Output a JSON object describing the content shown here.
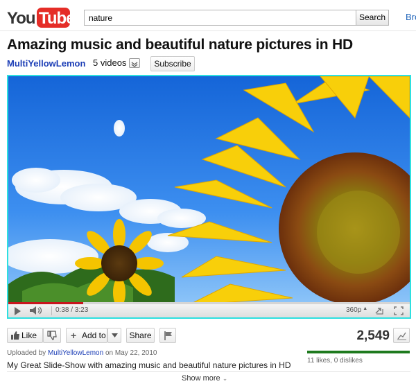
{
  "header": {
    "logo_text": "YouTube",
    "search_value": "nature",
    "search_button_label": "Search",
    "browse_link": "Bro"
  },
  "video": {
    "title": "Amazing music and beautiful nature pictures in HD",
    "channel": "MultiYellowLemon",
    "videos_count_label": "5 videos",
    "subscribe_label": "Subscribe"
  },
  "player": {
    "time": "0:38 / 3:23",
    "progress_fraction": 0.187,
    "quality": "360p"
  },
  "actions": {
    "like_label": "Like",
    "add_to_label": "Add to",
    "share_label": "Share",
    "view_count": "2,549"
  },
  "meta": {
    "uploaded_prefix": "Uploaded by",
    "uploader": "MultiYellowLemon",
    "uploaded_date": "on May 22, 2010",
    "description": "My Great Slide-Show with amazing music and beautiful nature pictures in HD",
    "likes_summary": "11 likes, 0 dislikes",
    "show_more_label": "Show more"
  },
  "colors": {
    "youtube_red": "#e52d27",
    "channel_link": "#1c3eb6",
    "player_border": "#2de0e0",
    "progress_played": "#c8161d",
    "likes_bar": "#1e7a1e"
  }
}
